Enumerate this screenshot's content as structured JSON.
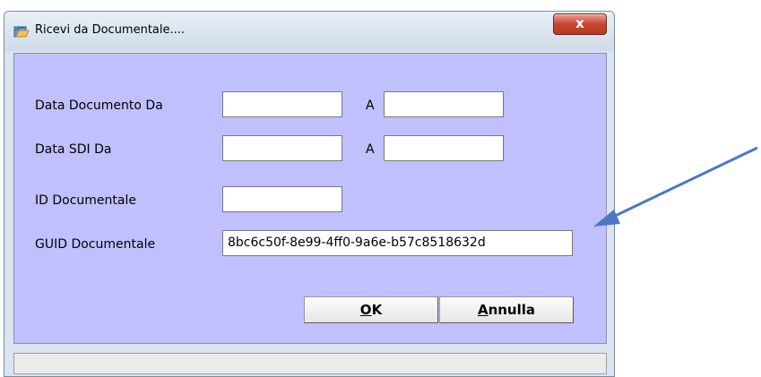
{
  "window": {
    "title": "Ricevi da Documentale....",
    "close_label": "x"
  },
  "form": {
    "data_documento_label": "Data Documento  Da",
    "data_documento_da": "",
    "data_documento_a_label": "A",
    "data_documento_a": "",
    "data_sdi_label": "Data SDI  Da",
    "data_sdi_da": "",
    "data_sdi_a_label": "A",
    "data_sdi_a": "",
    "id_documentale_label": "ID Documentale",
    "id_documentale": "",
    "guid_documentale_label": "GUID Documentale",
    "guid_documentale": "8bc6c50f-8e99-4ff0-9a6e-b57c8518632d"
  },
  "buttons": {
    "ok_mnemonic": "O",
    "ok_rest": "K",
    "annulla_mnemonic": "A",
    "annulla_rest": "nnulla"
  },
  "status": {
    "text": ""
  },
  "colors": {
    "client_bg": "#c0c0ff",
    "arrow": "#4a78c4"
  },
  "icons": {
    "title_icon": "folder-open-icon",
    "arrow": "annotation-arrow-icon"
  }
}
